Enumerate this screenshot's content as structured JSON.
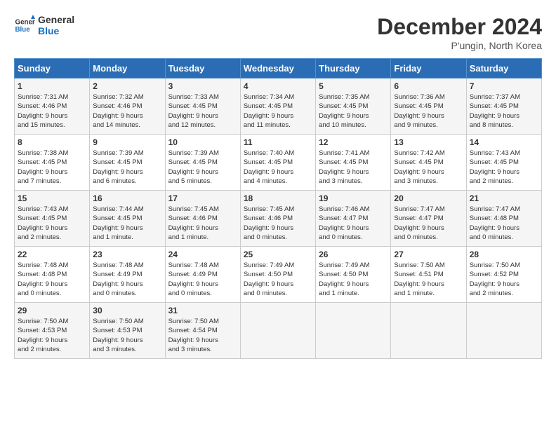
{
  "header": {
    "logo_line1": "General",
    "logo_line2": "Blue",
    "month_title": "December 2024",
    "location": "P'ungin, North Korea"
  },
  "days_of_week": [
    "Sunday",
    "Monday",
    "Tuesday",
    "Wednesday",
    "Thursday",
    "Friday",
    "Saturday"
  ],
  "weeks": [
    [
      {
        "day": "1",
        "info": "Sunrise: 7:31 AM\nSunset: 4:46 PM\nDaylight: 9 hours\nand 15 minutes."
      },
      {
        "day": "2",
        "info": "Sunrise: 7:32 AM\nSunset: 4:46 PM\nDaylight: 9 hours\nand 14 minutes."
      },
      {
        "day": "3",
        "info": "Sunrise: 7:33 AM\nSunset: 4:45 PM\nDaylight: 9 hours\nand 12 minutes."
      },
      {
        "day": "4",
        "info": "Sunrise: 7:34 AM\nSunset: 4:45 PM\nDaylight: 9 hours\nand 11 minutes."
      },
      {
        "day": "5",
        "info": "Sunrise: 7:35 AM\nSunset: 4:45 PM\nDaylight: 9 hours\nand 10 minutes."
      },
      {
        "day": "6",
        "info": "Sunrise: 7:36 AM\nSunset: 4:45 PM\nDaylight: 9 hours\nand 9 minutes."
      },
      {
        "day": "7",
        "info": "Sunrise: 7:37 AM\nSunset: 4:45 PM\nDaylight: 9 hours\nand 8 minutes."
      }
    ],
    [
      {
        "day": "8",
        "info": "Sunrise: 7:38 AM\nSunset: 4:45 PM\nDaylight: 9 hours\nand 7 minutes."
      },
      {
        "day": "9",
        "info": "Sunrise: 7:39 AM\nSunset: 4:45 PM\nDaylight: 9 hours\nand 6 minutes."
      },
      {
        "day": "10",
        "info": "Sunrise: 7:39 AM\nSunset: 4:45 PM\nDaylight: 9 hours\nand 5 minutes."
      },
      {
        "day": "11",
        "info": "Sunrise: 7:40 AM\nSunset: 4:45 PM\nDaylight: 9 hours\nand 4 minutes."
      },
      {
        "day": "12",
        "info": "Sunrise: 7:41 AM\nSunset: 4:45 PM\nDaylight: 9 hours\nand 3 minutes."
      },
      {
        "day": "13",
        "info": "Sunrise: 7:42 AM\nSunset: 4:45 PM\nDaylight: 9 hours\nand 3 minutes."
      },
      {
        "day": "14",
        "info": "Sunrise: 7:43 AM\nSunset: 4:45 PM\nDaylight: 9 hours\nand 2 minutes."
      }
    ],
    [
      {
        "day": "15",
        "info": "Sunrise: 7:43 AM\nSunset: 4:45 PM\nDaylight: 9 hours\nand 2 minutes."
      },
      {
        "day": "16",
        "info": "Sunrise: 7:44 AM\nSunset: 4:45 PM\nDaylight: 9 hours\nand 1 minute."
      },
      {
        "day": "17",
        "info": "Sunrise: 7:45 AM\nSunset: 4:46 PM\nDaylight: 9 hours\nand 1 minute."
      },
      {
        "day": "18",
        "info": "Sunrise: 7:45 AM\nSunset: 4:46 PM\nDaylight: 9 hours\nand 0 minutes."
      },
      {
        "day": "19",
        "info": "Sunrise: 7:46 AM\nSunset: 4:47 PM\nDaylight: 9 hours\nand 0 minutes."
      },
      {
        "day": "20",
        "info": "Sunrise: 7:47 AM\nSunset: 4:47 PM\nDaylight: 9 hours\nand 0 minutes."
      },
      {
        "day": "21",
        "info": "Sunrise: 7:47 AM\nSunset: 4:48 PM\nDaylight: 9 hours\nand 0 minutes."
      }
    ],
    [
      {
        "day": "22",
        "info": "Sunrise: 7:48 AM\nSunset: 4:48 PM\nDaylight: 9 hours\nand 0 minutes."
      },
      {
        "day": "23",
        "info": "Sunrise: 7:48 AM\nSunset: 4:49 PM\nDaylight: 9 hours\nand 0 minutes."
      },
      {
        "day": "24",
        "info": "Sunrise: 7:48 AM\nSunset: 4:49 PM\nDaylight: 9 hours\nand 0 minutes."
      },
      {
        "day": "25",
        "info": "Sunrise: 7:49 AM\nSunset: 4:50 PM\nDaylight: 9 hours\nand 0 minutes."
      },
      {
        "day": "26",
        "info": "Sunrise: 7:49 AM\nSunset: 4:50 PM\nDaylight: 9 hours\nand 1 minute."
      },
      {
        "day": "27",
        "info": "Sunrise: 7:50 AM\nSunset: 4:51 PM\nDaylight: 9 hours\nand 1 minute."
      },
      {
        "day": "28",
        "info": "Sunrise: 7:50 AM\nSunset: 4:52 PM\nDaylight: 9 hours\nand 2 minutes."
      }
    ],
    [
      {
        "day": "29",
        "info": "Sunrise: 7:50 AM\nSunset: 4:53 PM\nDaylight: 9 hours\nand 2 minutes."
      },
      {
        "day": "30",
        "info": "Sunrise: 7:50 AM\nSunset: 4:53 PM\nDaylight: 9 hours\nand 3 minutes."
      },
      {
        "day": "31",
        "info": "Sunrise: 7:50 AM\nSunset: 4:54 PM\nDaylight: 9 hours\nand 3 minutes."
      },
      {
        "day": "",
        "info": ""
      },
      {
        "day": "",
        "info": ""
      },
      {
        "day": "",
        "info": ""
      },
      {
        "day": "",
        "info": ""
      }
    ]
  ]
}
